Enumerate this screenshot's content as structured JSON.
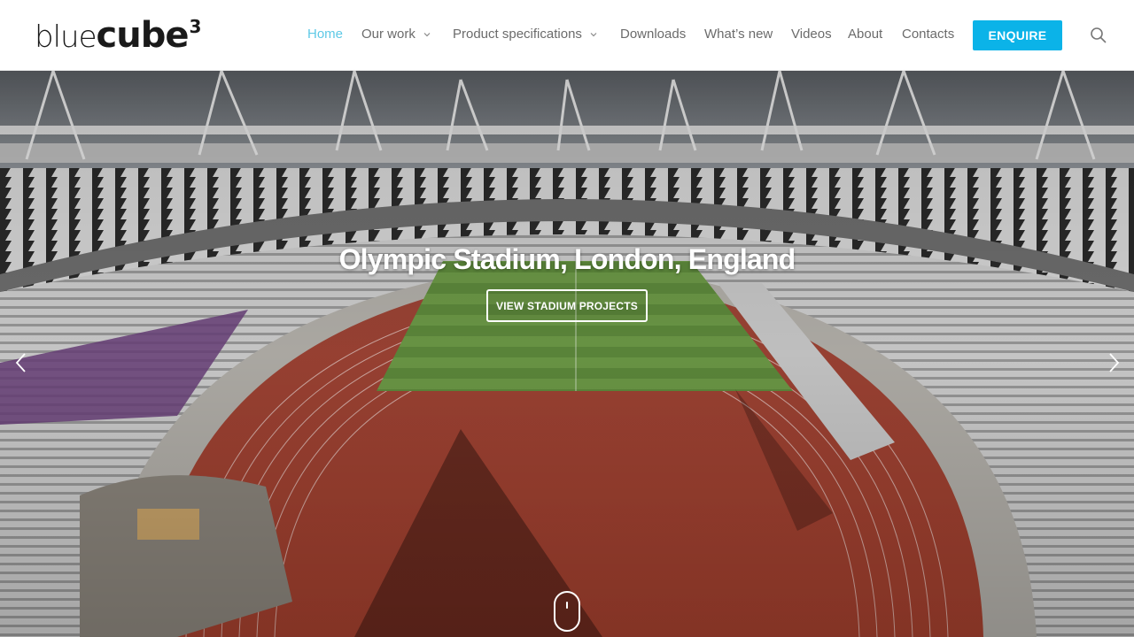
{
  "logo": {
    "light": "blue",
    "bold": "cube",
    "sup": "3"
  },
  "nav": {
    "items": [
      {
        "label": "Home",
        "active": true,
        "has_dropdown": false
      },
      {
        "label": "Our work",
        "active": false,
        "has_dropdown": true
      },
      {
        "label": "Product specifications",
        "active": false,
        "has_dropdown": true
      },
      {
        "label": "Downloads",
        "active": false,
        "has_dropdown": false
      },
      {
        "label": "What’s new",
        "active": false,
        "has_dropdown": false
      },
      {
        "label": "Videos",
        "active": false,
        "has_dropdown": false
      },
      {
        "label": "About",
        "active": false,
        "has_dropdown": false
      },
      {
        "label": "Contacts",
        "active": false,
        "has_dropdown": false
      }
    ],
    "enquire_label": "ENQUIRE",
    "search_icon": "search-icon"
  },
  "hero": {
    "title": "Olympic Stadium, London, England",
    "cta_label": "VIEW STADIUM PROJECTS",
    "prev_icon": "chevron-left-icon",
    "next_icon": "chevron-right-icon",
    "scroll_icon": "mouse-scroll-icon"
  },
  "colors": {
    "accent": "#0bb3e8",
    "active_nav": "#5ec9e6",
    "nav_text": "#6b6b6b"
  }
}
